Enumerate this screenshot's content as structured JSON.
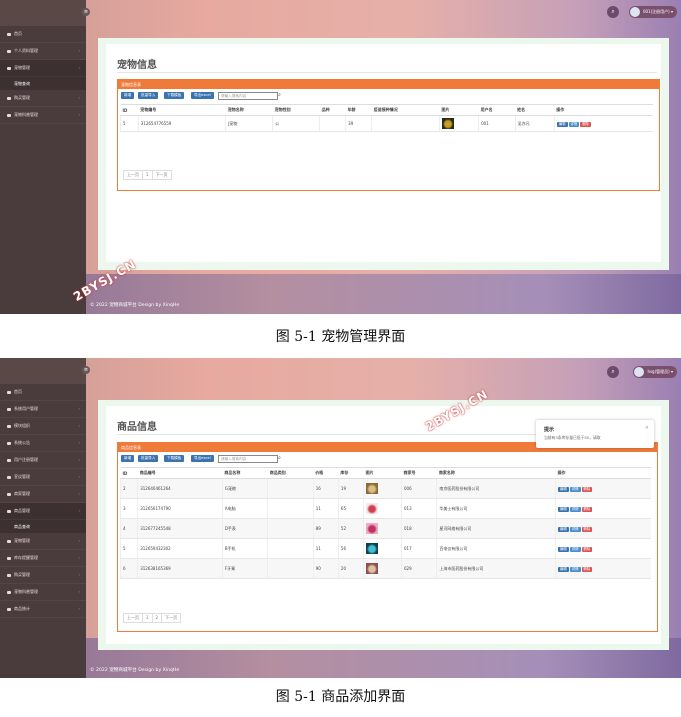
{
  "screens": [
    {
      "user": "001(注册用户)",
      "menu": [
        {
          "label": "首页",
          "sub": null
        },
        {
          "label": "个人资料管理",
          "sub": null
        },
        {
          "label": "宠物管理",
          "sub": "宠物查询"
        },
        {
          "label": "购买管理",
          "sub": null
        },
        {
          "label": "宠物科普管理",
          "sub": null
        }
      ],
      "page_title": "宠物信息",
      "table_title": "宠物信息表",
      "toolbar": {
        "add": "新增",
        "import": "批量导入",
        "template": "下载模板",
        "export": "导出excel",
        "search_placeholder": "请输入搜索内容"
      },
      "columns": [
        "ID",
        "宠物编号",
        "宠物名称",
        "宠物性别",
        "品种",
        "年龄",
        "疫苗接种情况",
        "图片",
        "用户名",
        "姓名",
        "操作"
      ],
      "rows": [
        [
          "5",
          "312654776559",
          "J宠物",
          "公",
          "",
          "39",
          "",
          "",
          "001",
          "吴亦凡"
        ]
      ],
      "ops": {
        "edit": "编辑",
        "detail": "详情",
        "del": "删除"
      },
      "pager": [
        "上一页",
        "1",
        "下一页"
      ],
      "footer": "© 2022 宠物商城平台 Design by XinqHe",
      "watermark": "2BYSJ.CN"
    },
    {
      "user": "hsg(管理员)",
      "menu": [
        {
          "label": "首页",
          "sub": null
        },
        {
          "label": "系统用户管理",
          "sub": null
        },
        {
          "label": "模块组织",
          "sub": null
        },
        {
          "label": "系统公告",
          "sub": null
        },
        {
          "label": "用户注册管理",
          "sub": null
        },
        {
          "label": "宣议管理",
          "sub": null
        },
        {
          "label": "商家管理",
          "sub": null
        },
        {
          "label": "商品管理",
          "sub": "商品查询"
        },
        {
          "label": "宠物管理",
          "sub": null
        },
        {
          "label": "库存提醒管理",
          "sub": null
        },
        {
          "label": "购买管理",
          "sub": null
        },
        {
          "label": "宠物科普管理",
          "sub": null
        },
        {
          "label": "商品统计",
          "sub": null
        }
      ],
      "page_title": "商品信息",
      "table_title": "商品信息表",
      "toolbar": {
        "add": "新增",
        "import": "批量导入",
        "template": "下载模板",
        "export": "导出excel",
        "search_placeholder": "请输入搜索内容"
      },
      "columns": [
        "ID",
        "商品编号",
        "商品名称",
        "商品类别",
        "价格",
        "库存",
        "图片",
        "商家号",
        "商家名称",
        "操作"
      ],
      "rows": [
        [
          "2",
          "312640461264",
          "G宠粮",
          "",
          "16",
          "19",
          "",
          "006",
          "南京医药股份有限公司"
        ],
        [
          "3",
          "312656174790",
          "A电脑",
          "",
          "11",
          "65",
          "",
          "013",
          "华美士有限公司"
        ],
        [
          "4",
          "312677245548",
          "D手表",
          "",
          "89",
          "52",
          "",
          "018",
          "星河网络有限公司"
        ],
        [
          "5",
          "312659432302",
          "B手机",
          "",
          "11",
          "56",
          "",
          "017",
          "百电仪有限公司"
        ],
        [
          "6",
          "312638165369",
          "F牙膏",
          "",
          "90",
          "20",
          "",
          "029",
          "上海市医药股份有限公司"
        ]
      ],
      "ops": {
        "edit": "编辑",
        "detail": "详情",
        "del": "删除"
      },
      "pager": [
        "上一页",
        "1",
        "2",
        "下一页"
      ],
      "toast": {
        "title": "提示",
        "message": "当前有3条库存量已低于50，请取",
        "close": "×"
      },
      "footer": "© 2022 宠物商城平台 Design by XinqHe",
      "watermark": "2BYSJ.CN"
    }
  ],
  "captions": [
    "图 5-1  宠物管理界面",
    "图 5-1 商品添加界面"
  ],
  "icons": {
    "menu_toggle": "menu-icon",
    "search": "search-icon",
    "home": "home-icon"
  }
}
